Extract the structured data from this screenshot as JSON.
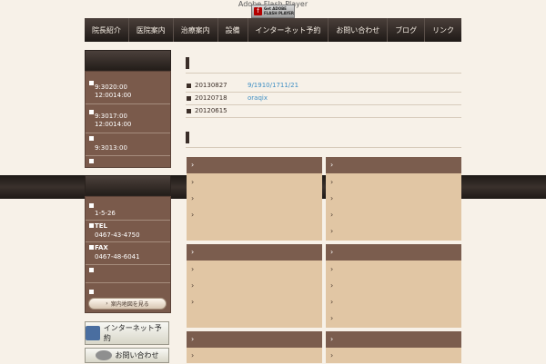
{
  "top": {
    "flash_label": "Adobe Flash Player",
    "flash_badge_text": "Get ADOBE FLASH PLAYER"
  },
  "nav": {
    "items": [
      "院長紹介",
      "医院案内",
      "治療案内",
      "設備",
      "インターネット予約",
      "お問い合わせ",
      "ブログ",
      "リンク"
    ]
  },
  "sidebar": {
    "hours": [
      "9:3020:00",
      "12:0014:00",
      "9:3017:00",
      "12:0014:00",
      "9:3013:00"
    ],
    "info": {
      "address": "1-5-26",
      "tel_label": "TEL",
      "tel": "0467-43-4750",
      "fax_label": "FAX",
      "fax": "0467-48-6041",
      "map_button": "案内地図を見る"
    },
    "banner_reserve": "インターネット予約",
    "banner_contact": "お問い合わせ"
  },
  "main": {
    "news": [
      {
        "date": "20130827",
        "text": "9/1910/1711/21"
      },
      {
        "date": "20120718",
        "text": "oraqix"
      },
      {
        "date": "20120615",
        "text": ""
      }
    ],
    "grid_arrow": "›"
  },
  "colors": {
    "accent": "#7b5d4e",
    "panel": "#e1c6a4",
    "nav": "#2b2420",
    "link": "#3f8fc4",
    "background": "#f7f1e8"
  }
}
